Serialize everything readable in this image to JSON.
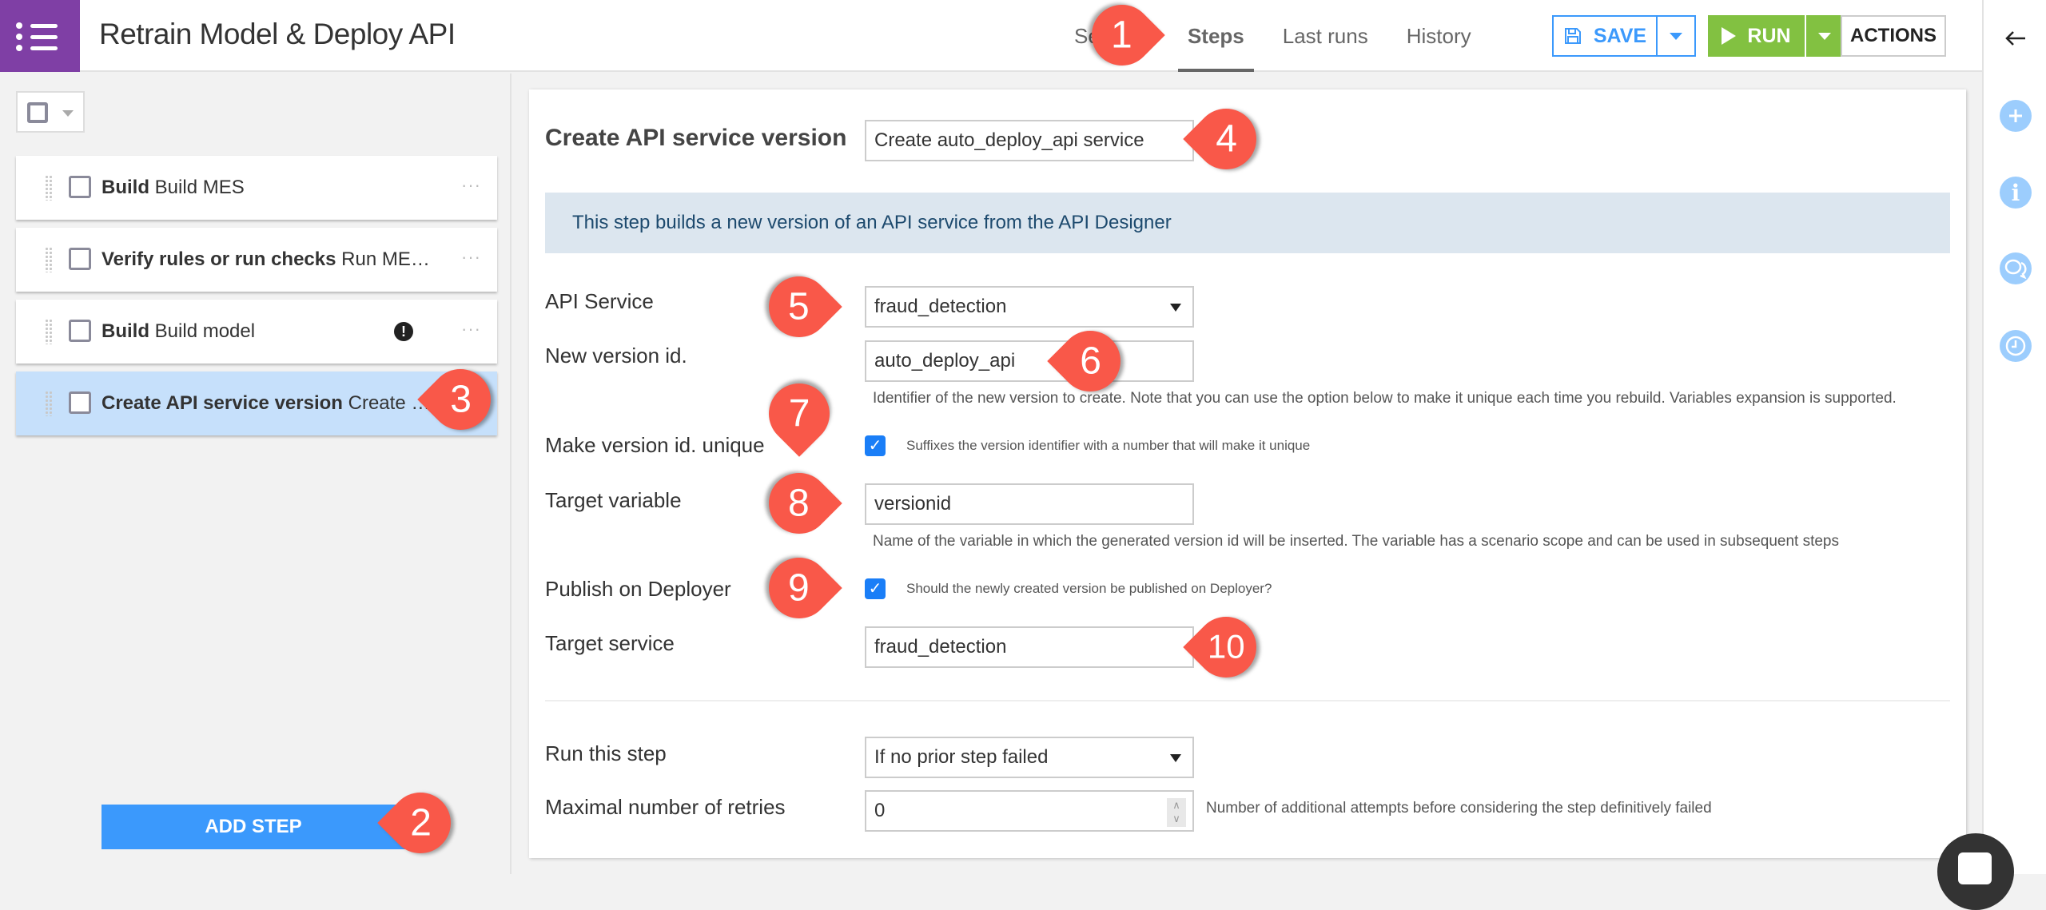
{
  "header": {
    "title": "Retrain Model & Deploy API",
    "tabs": [
      {
        "label": "Settings",
        "active": false
      },
      {
        "label": "Steps",
        "active": true
      },
      {
        "label": "Last runs",
        "active": false
      },
      {
        "label": "History",
        "active": false
      }
    ],
    "save_label": "SAVE",
    "run_label": "RUN",
    "actions_label": "ACTIONS"
  },
  "right_rail": {
    "icons": [
      "back-arrow-icon",
      "add-icon",
      "info-icon",
      "discussions-icon",
      "history-clock-icon"
    ]
  },
  "steps_panel": {
    "steps": [
      {
        "type": "Build",
        "name": "Build MES",
        "selected": false,
        "warning": false
      },
      {
        "type": "Verify rules or run checks",
        "name": "Run ME…",
        "selected": false,
        "warning": false
      },
      {
        "type": "Build",
        "name": "Build model",
        "selected": false,
        "warning": true
      },
      {
        "type": "Create API service version",
        "name": "Create …",
        "selected": true,
        "warning": false
      }
    ],
    "more_glyph": "···",
    "warning_glyph": "!",
    "add_step_label": "ADD STEP"
  },
  "step_editor": {
    "title": "Create API service version",
    "step_name": "Create auto_deploy_api service",
    "info": "This step builds a new version of an API service from the API Designer",
    "fields": {
      "api_service": {
        "label": "API Service",
        "value": "fraud_detection"
      },
      "new_version_id": {
        "label": "New version id.",
        "value": "auto_deploy_api",
        "help": "Identifier of the new version to create. Note that you can use the option below to make it unique each time you rebuild. Variables expansion is supported."
      },
      "make_unique": {
        "label": "Make version id. unique",
        "checked": true,
        "help": "Suffixes the version identifier with a number that will make it unique"
      },
      "target_variable": {
        "label": "Target variable",
        "value": "versionid",
        "help": "Name of the variable in which the generated version id will be inserted. The variable has a scenario scope and can be used in subsequent steps"
      },
      "publish_on_deployer": {
        "label": "Publish on Deployer",
        "checked": true,
        "help": "Should the newly created version be published on Deployer?"
      },
      "target_service": {
        "label": "Target service",
        "value": "fraud_detection"
      },
      "run_this_step": {
        "label": "Run this step",
        "value": "If no prior step failed"
      },
      "max_retries": {
        "label": "Maximal number of retries",
        "value": "0",
        "help": "Number of additional attempts before considering the step definitively failed"
      }
    },
    "check_glyph": "✓"
  },
  "callouts": [
    "1",
    "2",
    "3",
    "4",
    "5",
    "6",
    "7",
    "8",
    "9",
    "10"
  ],
  "colors": {
    "brand_purple": "#7f3fa5",
    "save_blue": "#3b99fc",
    "run_green": "#82c141",
    "callout_red": "#f95849",
    "selected_step": "#c6e0fb",
    "info_banner": "#dce6ef"
  }
}
